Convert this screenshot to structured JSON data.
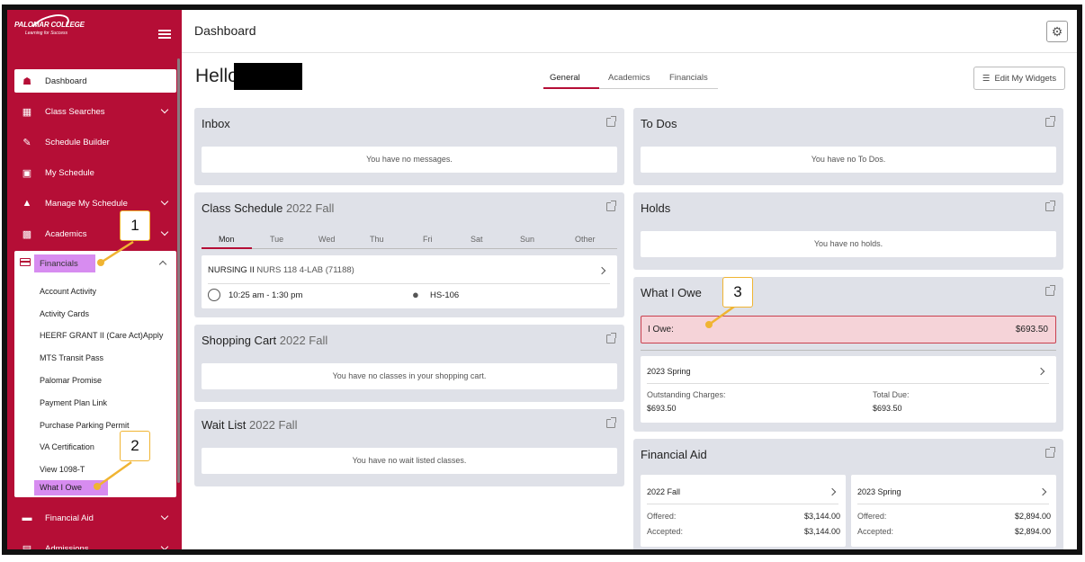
{
  "sidebar": {
    "logo_text": "PALOMAR COLLEGE",
    "logo_tagline": "Learning for Success",
    "items": [
      {
        "label": "Dashboard",
        "icon": "home-icon"
      },
      {
        "label": "Class Searches",
        "icon": "search-list-icon"
      },
      {
        "label": "Schedule Builder",
        "icon": "edit-icon"
      },
      {
        "label": "My Schedule",
        "icon": "calendar-icon"
      },
      {
        "label": "Manage My Schedule",
        "icon": "graduation-cap-icon"
      },
      {
        "label": "Academics",
        "icon": "document-icon"
      },
      {
        "label": "Financials",
        "icon": "credit-card-icon"
      },
      {
        "label": "Financial Aid",
        "icon": "folder-icon"
      },
      {
        "label": "Admissions",
        "icon": "id-card-icon"
      }
    ],
    "financials_sub": [
      "Account Activity",
      "Activity Cards",
      "HEERF GRANT II (Care Act)Apply",
      "MTS Transit Pass",
      "Palomar Promise",
      "Payment Plan Link",
      "Purchase Parking Permit",
      "VA Certification",
      "View 1098-T",
      "What I Owe"
    ]
  },
  "header": {
    "title": "Dashboard"
  },
  "main": {
    "greeting": "Hello",
    "tabs": [
      "General",
      "Academics",
      "Financials"
    ],
    "edit_label": "Edit My Widgets"
  },
  "inbox": {
    "title": "Inbox",
    "empty": "You have no messages."
  },
  "todos": {
    "title": "To Dos",
    "empty": "You have no To Dos."
  },
  "schedule": {
    "title": "Class Schedule",
    "term": "2022 Fall",
    "days": [
      "Mon",
      "Tue",
      "Wed",
      "Thu",
      "Fri",
      "Sat",
      "Sun",
      "Other"
    ],
    "course_name": "NURSING II",
    "course_code": "NURS 118 4-LAB (71188)",
    "time": "10:25 am - 1:30 pm",
    "room": "HS-106"
  },
  "holds": {
    "title": "Holds",
    "empty": "You have no holds."
  },
  "cart": {
    "title": "Shopping Cart",
    "term": "2022 Fall",
    "empty": "You have no classes in your shopping cart."
  },
  "owe": {
    "title": "What I Owe",
    "label": "I Owe:",
    "amount": "$693.50",
    "term": "2023 Spring",
    "oc_label": "Outstanding Charges:",
    "oc_value": "$693.50",
    "td_label": "Total Due:",
    "td_value": "$693.50"
  },
  "waitlist": {
    "title": "Wait List",
    "term": "2022 Fall",
    "empty": "You have no wait listed classes."
  },
  "aid": {
    "title": "Financial Aid",
    "terms": [
      {
        "term": "2022 Fall",
        "offered_label": "Offered:",
        "offered": "$3,144.00",
        "accepted_label": "Accepted:",
        "accepted": "$3,144.00"
      },
      {
        "term": "2023 Spring",
        "offered_label": "Offered:",
        "offered": "$2,894.00",
        "accepted_label": "Accepted:",
        "accepted": "$2,894.00"
      }
    ]
  },
  "callouts": [
    "1",
    "2",
    "3"
  ],
  "colors": {
    "brand": "#b50e36",
    "highlight": "#d78cf0",
    "callout_border": "#f0b432",
    "owe_bg": "#f5d3d8"
  }
}
